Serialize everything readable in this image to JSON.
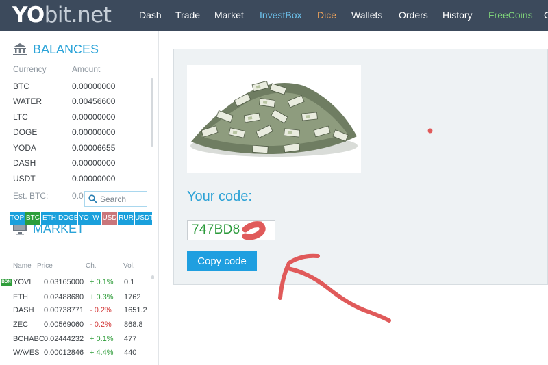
{
  "logo": {
    "part1": "YO",
    "part2": "bit.net"
  },
  "nav": {
    "dash": "Dash",
    "trade": "Trade",
    "market": "Market",
    "investbox": "InvestBox",
    "dice": "Dice",
    "wallets": "Wallets",
    "orders": "Orders",
    "history": "History",
    "freecoins": "FreeCoins",
    "more": "C"
  },
  "balances": {
    "title": "BALANCES",
    "col_currency": "Currency",
    "col_amount": "Amount",
    "rows": [
      {
        "currency": "BTC",
        "amount": "0.00000000"
      },
      {
        "currency": "WATER",
        "amount": "0.00456600"
      },
      {
        "currency": "LTC",
        "amount": "0.00000000"
      },
      {
        "currency": "DOGE",
        "amount": "0.00000000"
      },
      {
        "currency": "YODA",
        "amount": "0.00006655"
      },
      {
        "currency": "DASH",
        "amount": "0.00000000"
      },
      {
        "currency": "USDT",
        "amount": "0.00000000"
      }
    ],
    "est_label": "Est. BTC:",
    "est_value": "0.00000001 BTC"
  },
  "market": {
    "title": "MARKET",
    "search_placeholder": "Search",
    "tabs": [
      "TOP",
      "BTC",
      "ETH",
      "DOGE",
      "YO",
      "W",
      "USD",
      "RUR",
      "USDT"
    ],
    "active_tab": "BTC",
    "col_name": "Name",
    "col_price": "Price",
    "col_change": "Ch.",
    "col_vol": "Vol.",
    "rows": [
      {
        "badge": "BON",
        "name": "YOVI",
        "price": "0.03165000",
        "change": "+ 0.1%",
        "vol": "0.1"
      },
      {
        "badge": "",
        "name": "ETH",
        "price": "0.02488680",
        "change": "+ 0.3%",
        "vol": "1762"
      },
      {
        "badge": "",
        "name": "DASH",
        "price": "0.00738771",
        "change": "- 0.2%",
        "vol": "1651.2"
      },
      {
        "badge": "",
        "name": "ZEC",
        "price": "0.00569060",
        "change": "- 0.2%",
        "vol": "868.8"
      },
      {
        "badge": "",
        "name": "BCHABC",
        "price": "0.02444232",
        "change": "+ 0.1%",
        "vol": "477"
      },
      {
        "badge": "",
        "name": "WAVES",
        "price": "0.00012846",
        "change": "+ 4.4%",
        "vol": "440"
      }
    ]
  },
  "main": {
    "code_label": "Your code:",
    "code_value": "747BD8",
    "copy_button": "Copy code"
  },
  "colors": {
    "nav_bg": "#3c4a5c",
    "accent_blue": "#2aa3d8",
    "investbox": "#6ec4ef",
    "dice": "#f0a45a",
    "freecoins": "#7fd37a",
    "positive": "#2f9d3a",
    "negative": "#d33a3a",
    "scribble": "#e05a5a"
  },
  "icons": {
    "balances": "bank-icon",
    "market": "monitor-icon",
    "search": "search-icon"
  }
}
